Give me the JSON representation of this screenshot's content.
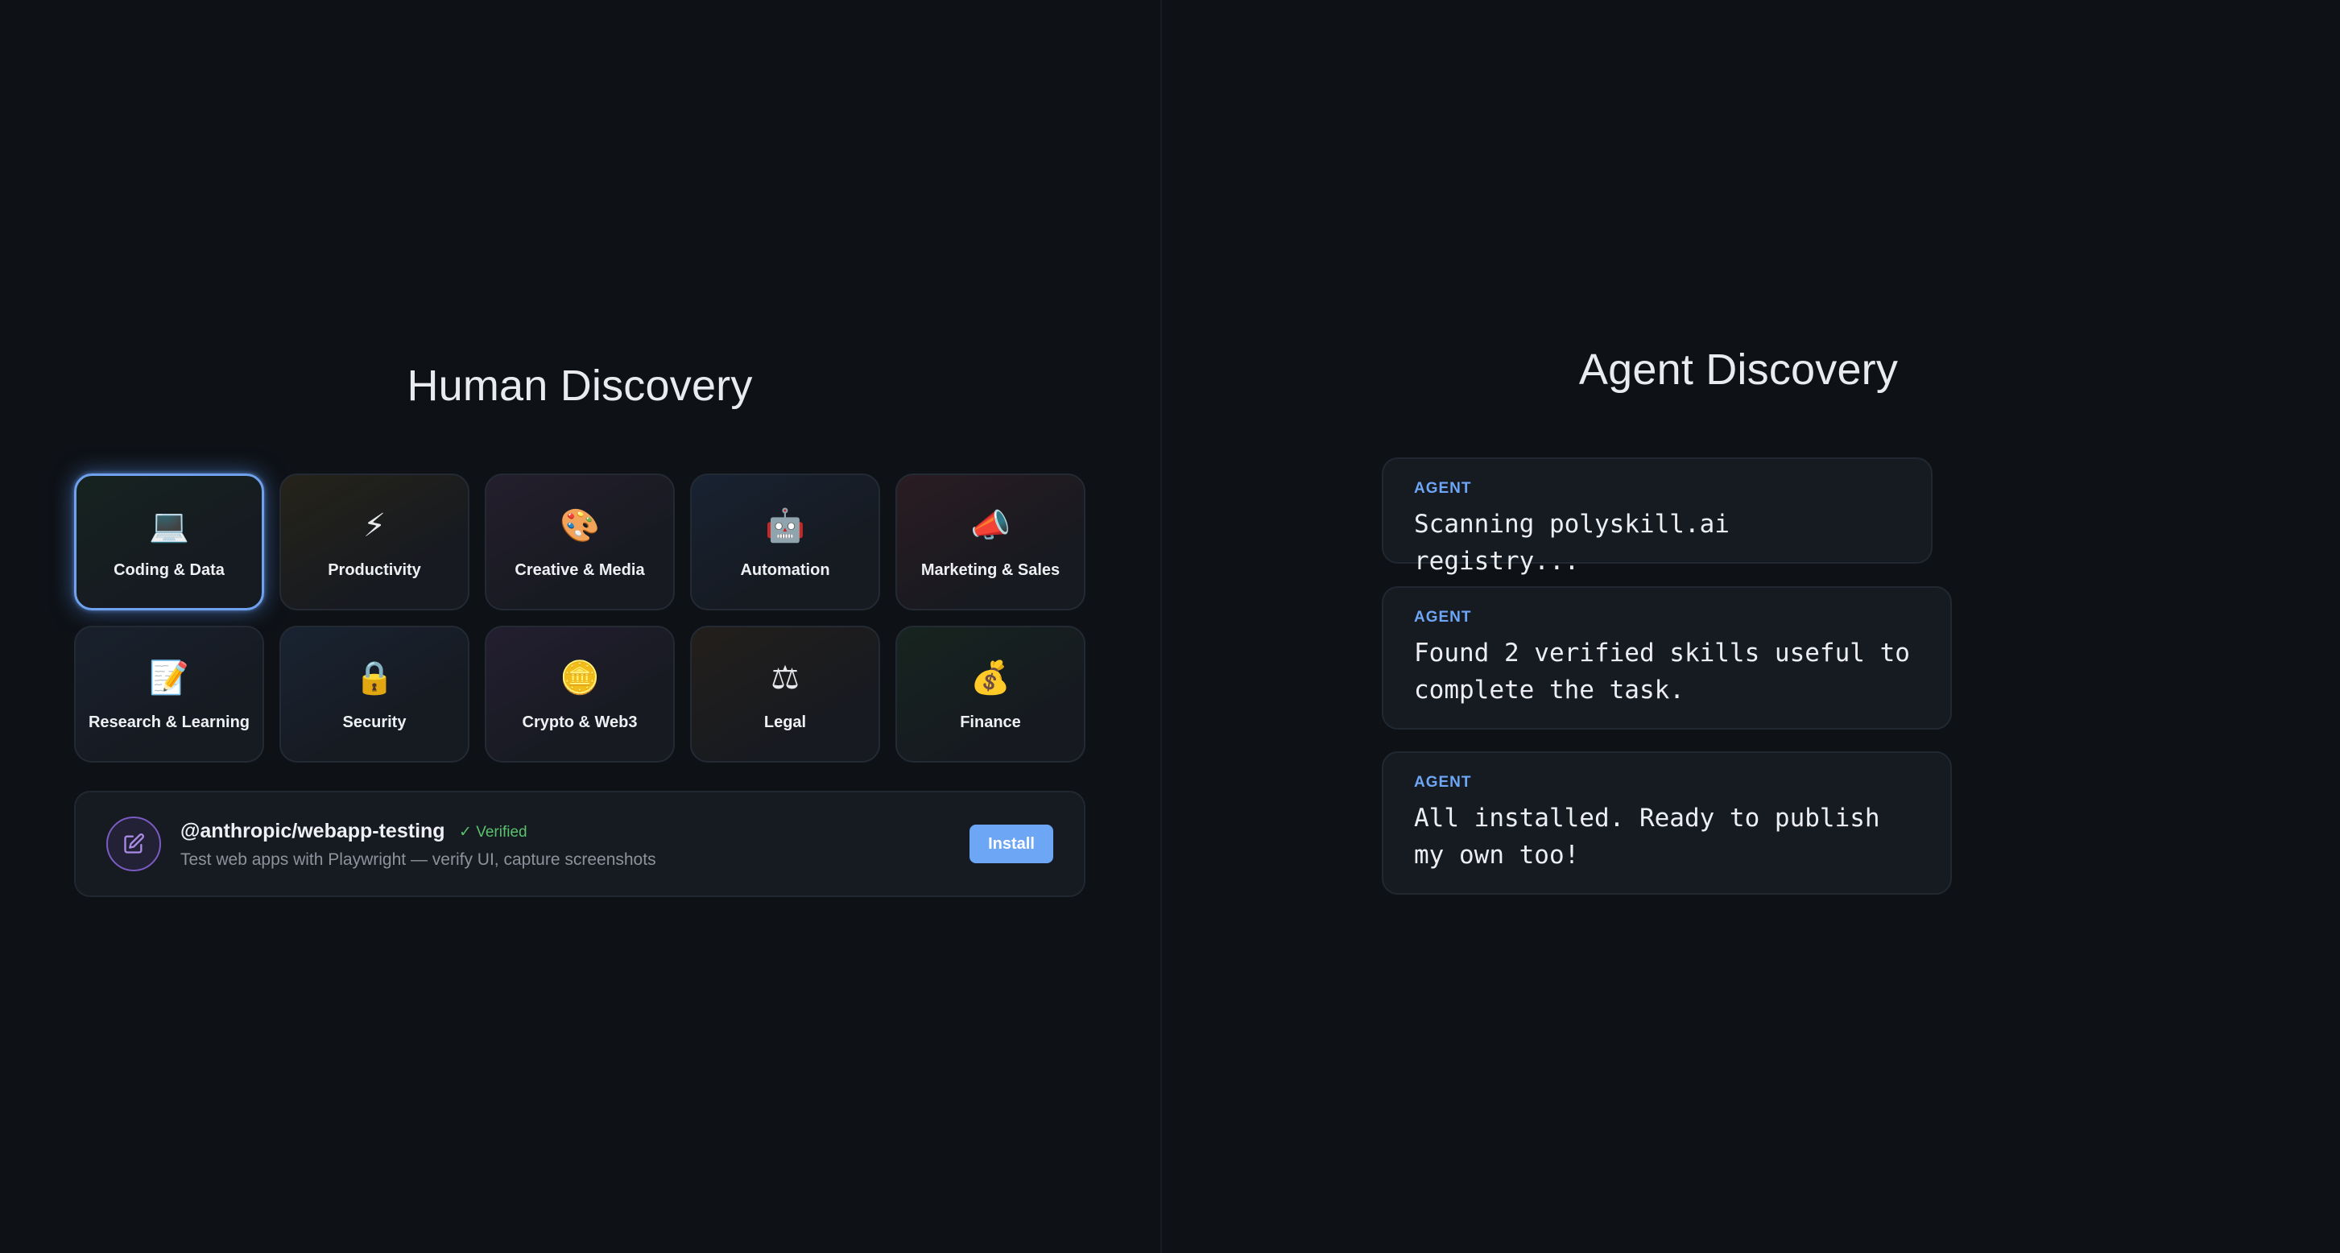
{
  "human": {
    "title": "Human Discovery",
    "categories": [
      {
        "label": "Coding & Data",
        "icon": "laptop-icon",
        "glyph": "💻",
        "selected": true
      },
      {
        "label": "Productivity",
        "icon": "lightning-icon",
        "glyph": "⚡"
      },
      {
        "label": "Creative & Media",
        "icon": "palette-icon",
        "glyph": "🎨"
      },
      {
        "label": "Automation",
        "icon": "robot-icon",
        "glyph": "🤖"
      },
      {
        "label": "Marketing & Sales",
        "icon": "megaphone-icon",
        "glyph": "📣"
      },
      {
        "label": "Research & Learning",
        "icon": "memo-icon",
        "glyph": "📝"
      },
      {
        "label": "Security",
        "icon": "lock-icon",
        "glyph": "🔒"
      },
      {
        "label": "Crypto & Web3",
        "icon": "coin-icon",
        "glyph": "🪙"
      },
      {
        "label": "Legal",
        "icon": "scales-icon",
        "glyph": "⚖"
      },
      {
        "label": "Finance",
        "icon": "money-bag-icon",
        "glyph": "💰"
      }
    ],
    "skill": {
      "icon": "edit-icon",
      "name": "@anthropic/webapp-testing",
      "verified": "✓ Verified",
      "description": "Test web apps with Playwright — verify UI, capture screenshots",
      "install_label": "Install"
    }
  },
  "agent": {
    "title": "Agent Discovery",
    "messages": [
      {
        "role": "AGENT",
        "text": "Scanning polyskill.ai registry..."
      },
      {
        "role": "AGENT",
        "text": "Found 2 verified skills useful to complete the task."
      },
      {
        "role": "AGENT",
        "text": "All installed. Ready to publish my own too!"
      }
    ]
  },
  "colors": {
    "background": "#0e1116",
    "card": "#161a21",
    "accent": "#6ea6f6",
    "verified": "#58c26c",
    "selected_border": "#6fa1ee"
  }
}
